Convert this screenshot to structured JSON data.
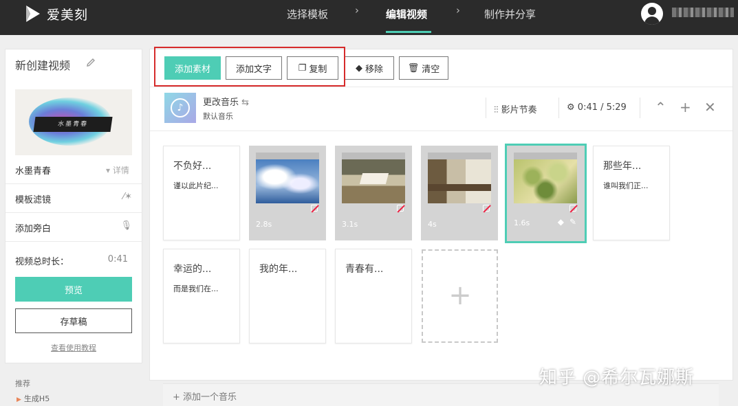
{
  "app": {
    "name": "爱美刻"
  },
  "nav": {
    "steps": [
      "选择模板",
      "编辑视频",
      "制作并分享"
    ],
    "active_index": 1
  },
  "sidebar": {
    "project_title": "新创建视频",
    "template_name": "水墨青春",
    "template_thumb_text": "水墨青春",
    "detail_link": "详情",
    "filter_label": "模板滤镜",
    "narration_label": "添加旁白",
    "duration_label": "视频总时长：",
    "duration_value": "0:41",
    "preview_button": "预览",
    "draft_button": "存草稿",
    "tutorial_link": "查看使用教程",
    "recommend_label": "推荐",
    "generate_h5": "生成H5"
  },
  "toolbar": {
    "add_material": "添加素材",
    "add_text": "添加文字",
    "copy": "复制",
    "remove": "移除",
    "clear": "清空"
  },
  "music": {
    "change_label": "更改音乐",
    "default_label": "默认音乐",
    "rhythm_label": "影片节奏",
    "time": "0:41 / 5:29"
  },
  "cards": [
    {
      "type": "text",
      "title": "不负好...",
      "subtitle": "谨以此片纪..."
    },
    {
      "type": "media",
      "duration": "2.8s",
      "scene": "sky"
    },
    {
      "type": "media",
      "duration": "3.1s",
      "scene": "classroom-book"
    },
    {
      "type": "media",
      "duration": "4s",
      "scene": "classroom-desks"
    },
    {
      "type": "media",
      "duration": "1.6s",
      "scene": "leaves",
      "selected": true
    },
    {
      "type": "text",
      "title": "那些年...",
      "subtitle": "谁叫我们正..."
    },
    {
      "type": "text",
      "title": "幸运的...",
      "subtitle": "而是我们在..."
    },
    {
      "type": "text",
      "title": "我的年...",
      "subtitle": ""
    },
    {
      "type": "text",
      "title": "青春有...",
      "subtitle": ""
    },
    {
      "type": "add"
    }
  ],
  "add_music_bar": "+ 添加一个音乐",
  "watermark": "知乎 @希尔瓦娜斯",
  "colors": {
    "accent": "#4ecdb5",
    "topbar": "#2b2b2b",
    "highlight": "#d62a2a"
  }
}
